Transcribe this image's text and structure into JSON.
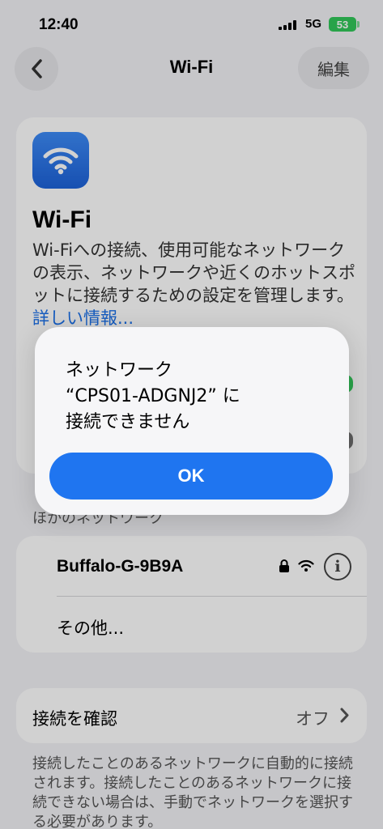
{
  "status": {
    "time": "12:40",
    "network": "5G",
    "battery": "53"
  },
  "nav": {
    "title": "Wi-Fi",
    "edit": "編集"
  },
  "wifi_card": {
    "title": "Wi-Fi",
    "description": "Wi-Fiへの接続、使用可能なネットワークの表示、ネットワークや近くのホットスポットに接続するための設定を管理します。",
    "link": "詳しい情報..."
  },
  "other_networks": {
    "header": "ほかのネットワーク",
    "items": [
      {
        "label": "Buffalo-G-9B9A"
      },
      {
        "label": "その他..."
      }
    ]
  },
  "ask_to_join": {
    "label": "接続を確認",
    "value": "オフ",
    "footnote": "接続したことのあるネットワークに自動的に接続されます。接続したことのあるネットワークに接続できない場合は、手動でネットワークを選択する必要があります。"
  },
  "alert": {
    "message": "ネットワーク\n“CPS01-ADGNJ2” に\n接続できません",
    "ok": "OK"
  },
  "colors": {
    "accent": "#1f75f0",
    "toggle_on": "#33c759"
  }
}
